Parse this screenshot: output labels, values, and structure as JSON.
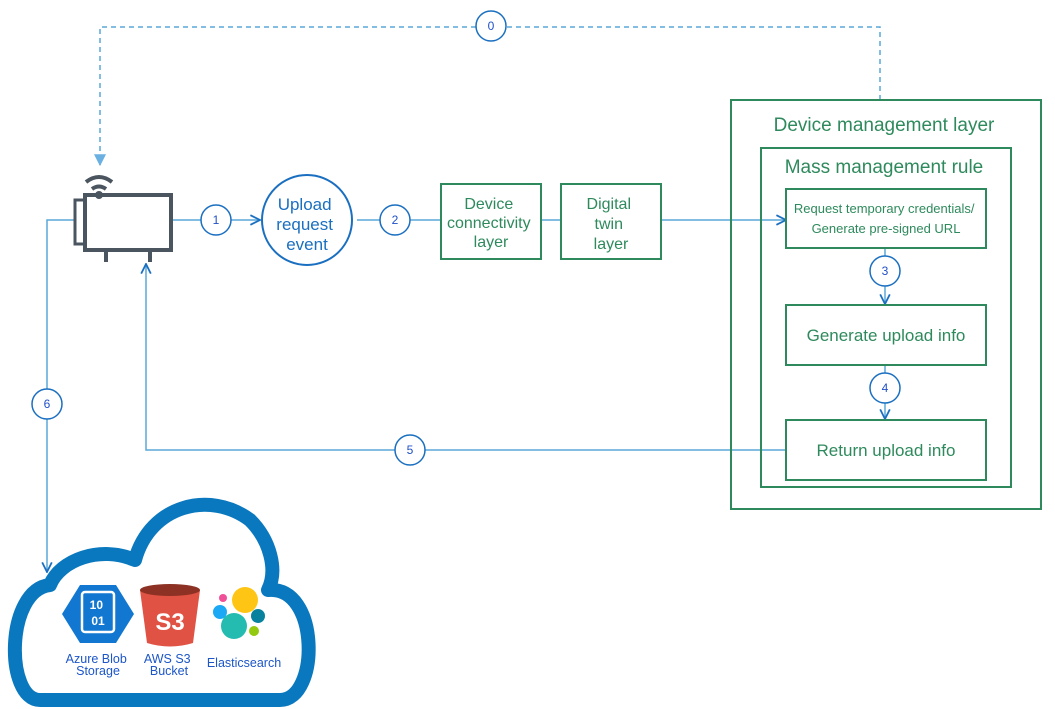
{
  "colors": {
    "green": "#2e8a5c",
    "blue": "#1a6fc0",
    "line": "#5aa8d8",
    "device": "#4a5560"
  },
  "steps": [
    "0",
    "1",
    "2",
    "3",
    "4",
    "5",
    "6"
  ],
  "upload_event": [
    "Upload",
    "request",
    "event"
  ],
  "connectivity": [
    "Device",
    "connectivity",
    "layer"
  ],
  "twin": [
    "Digital",
    "twin",
    "layer"
  ],
  "device_mgmt_title": "Device management layer",
  "mass_rule_title": "Mass management rule",
  "request_creds": [
    "Request temporary credentials/",
    "Generate pre-signed URL"
  ],
  "generate_info": "Generate upload info",
  "return_info": "Return upload info",
  "cloud": {
    "azure": [
      "Azure Blob",
      "Storage"
    ],
    "azure_icon_text": [
      "10",
      "01"
    ],
    "s3": [
      "AWS S3",
      "Bucket"
    ],
    "s3_icon_text": "S3",
    "elastic": "Elasticsearch"
  },
  "icons": [
    "wifi-icon",
    "iot-device-icon",
    "cloud-icon",
    "azure-blob-icon",
    "aws-s3-icon",
    "elasticsearch-icon"
  ]
}
